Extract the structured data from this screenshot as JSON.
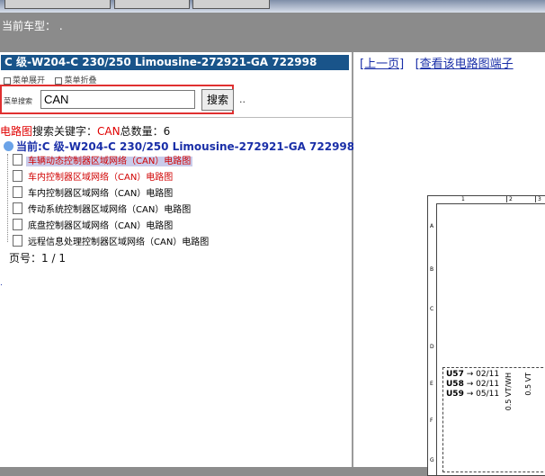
{
  "header": {
    "car_model_label": "当前车型：",
    "car_model_value": "."
  },
  "panel": {
    "title": "C 级-W204-C 230/250 Limousine-272921-GA 722998",
    "expand_label": "菜单展开",
    "collapse_label": "菜单折叠",
    "search_label": "菜单搜索",
    "search_value": "CAN",
    "search_button": "搜索",
    "dots": ".."
  },
  "summary": {
    "category": "电路图",
    "keyword_label": "搜索关键字：",
    "keyword": "CAN",
    "count_label": "总数量：",
    "count": "6"
  },
  "current": {
    "label": "当前:C 级-W204-C 230/250 Limousine-272921-GA 722998"
  },
  "tree_items": [
    {
      "label": "车辆动态控制器区域网络（CAN）电路图",
      "state": "selected"
    },
    {
      "label": "车内控制器区域网络（CAN）电路图",
      "state": "red"
    },
    {
      "label": "车内控制器区域网络（CAN）电路图",
      "state": "normal"
    },
    {
      "label": "传动系统控制器区域网络（CAN）电路图",
      "state": "normal"
    },
    {
      "label": "底盘控制器区域网络（CAN）电路图",
      "state": "normal"
    },
    {
      "label": "远程信息处理控制器区域网络（CAN）电路图",
      "state": "normal"
    }
  ],
  "pagination": {
    "label": "页号：",
    "value": "1 / 1"
  },
  "right": {
    "prev_link": "[上一页]",
    "terminal_link": "[查看该电路图端子"
  },
  "diagram": {
    "cols": [
      "1",
      "2",
      "3"
    ],
    "rows": [
      "A",
      "B",
      "C",
      "D",
      "E",
      "F",
      "G"
    ],
    "signals": [
      {
        "id": "U57",
        "ref": "02/11"
      },
      {
        "id": "U58",
        "ref": "02/11"
      },
      {
        "id": "U59",
        "ref": "05/11"
      }
    ],
    "wires": [
      "0.5 VT/WH",
      "0.5 VT"
    ]
  }
}
